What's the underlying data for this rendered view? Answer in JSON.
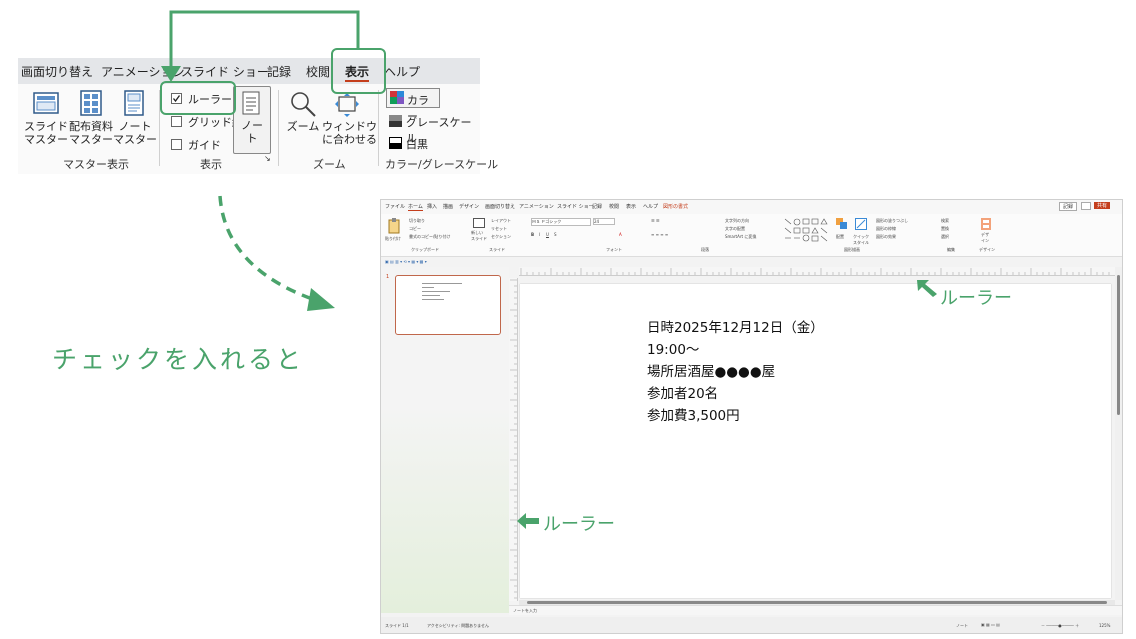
{
  "ribbon": {
    "tabs": [
      "画面切り替え",
      "アニメーション",
      "スライド ショー",
      "記録",
      "校閲",
      "表示",
      "ヘルプ"
    ],
    "active_tab": "表示",
    "groups": {
      "master": {
        "label": "マスター表示",
        "buttons": [
          {
            "label": "スライド\nマスター"
          },
          {
            "label": "配布資料\nマスター"
          },
          {
            "label": "ノート\nマスター"
          }
        ]
      },
      "show": {
        "label": "表示",
        "checkboxes": [
          {
            "label": "ルーラー",
            "checked": true
          },
          {
            "label": "グリッド線",
            "checked": false
          },
          {
            "label": "ガイド",
            "checked": false
          }
        ],
        "notes_button": "ノー\nト"
      },
      "zoom": {
        "label": "ズーム",
        "buttons": [
          {
            "label": "ズーム"
          },
          {
            "label": "ウィンドウ\nに合わせる"
          }
        ]
      },
      "color": {
        "label": "カラー/グレースケール",
        "options": [
          "カラー",
          "グレースケール",
          "白黒"
        ]
      }
    }
  },
  "caption": "チェックを入れると",
  "app": {
    "menu": [
      "ファイル",
      "ホーム",
      "挿入",
      "描画",
      "デザイン",
      "画面切り替え",
      "アニメーション",
      "スライド ショー",
      "記録",
      "校閲",
      "表示",
      "ヘルプ",
      "図形の書式"
    ],
    "record_button": "記録",
    "share_button": "共有",
    "ribbon_groups": [
      "クリップボード",
      "スライド",
      "フォント",
      "段落",
      "図形描画",
      "編集",
      "デザイン"
    ],
    "ribbon_items": {
      "paste": "貼り付け",
      "cut": "切り取り",
      "copy": "コピー",
      "format_copy": "書式のコピー/貼り付け",
      "new_slide": "新しい\nスライド",
      "layout": "レイアウト",
      "reset": "リセット",
      "section": "セクション",
      "font_name": "ＭＳ Ｐゴシック",
      "font_size": "24",
      "text_direction": "文字列の方向",
      "align_text": "文字の配置",
      "smartart": "SmartArt に変換",
      "arrange": "配置",
      "quick_style": "クイック\nスタイル",
      "shape_fill": "図形の塗りつぶし",
      "shape_outline": "図形の枠線",
      "shape_effect": "図形の効果",
      "find": "検索",
      "replace": "置換",
      "select": "選択",
      "designer": "デザ\nイン"
    },
    "slide_number": "1",
    "slide_lines": [
      "日時2025年12月12日（金）",
      "19:00〜",
      "場所居酒屋●●●●屋",
      "参加者20名",
      "参加費3,500円"
    ],
    "notes_placeholder": "ノートを入力",
    "status_left": "スライド 1/1",
    "status_accessibility": "アクセシビリティ: 問題ありません",
    "status_notes": "ノート",
    "zoom": "125%"
  },
  "callouts": {
    "ruler_top": "ルーラー",
    "ruler_left": "ルーラー"
  },
  "colors": {
    "accent_green": "#4aa36b",
    "active_tab_underline": "#c43e1c",
    "share_button": "#c43e1c"
  }
}
